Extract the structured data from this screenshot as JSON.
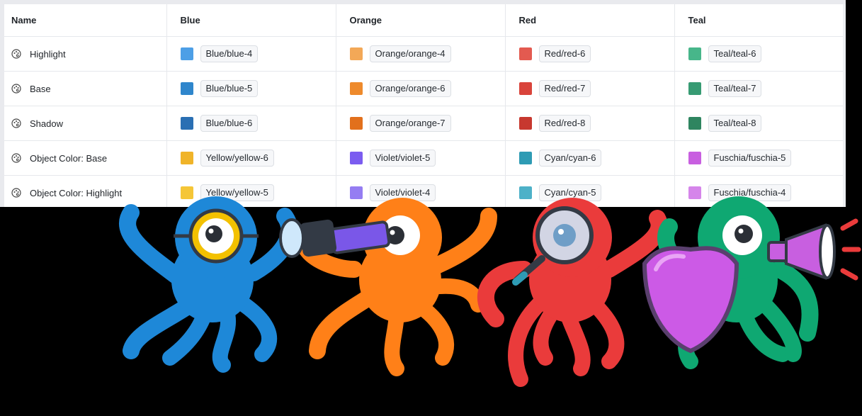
{
  "table": {
    "headers": [
      "Name",
      "Blue",
      "Orange",
      "Red",
      "Teal"
    ],
    "rows": [
      {
        "name": "Highlight",
        "cells": [
          {
            "label": "Blue/blue-4",
            "color": "#4d9fe6"
          },
          {
            "label": "Orange/orange-4",
            "color": "#f3a857"
          },
          {
            "label": "Red/red-6",
            "color": "#e35a50"
          },
          {
            "label": "Teal/teal-6",
            "color": "#47b68a"
          }
        ]
      },
      {
        "name": "Base",
        "cells": [
          {
            "label": "Blue/blue-5",
            "color": "#2f86cc"
          },
          {
            "label": "Orange/orange-6",
            "color": "#ee8a2c"
          },
          {
            "label": "Red/red-7",
            "color": "#d9443b"
          },
          {
            "label": "Teal/teal-7",
            "color": "#379b73"
          }
        ]
      },
      {
        "name": "Shadow",
        "cells": [
          {
            "label": "Blue/blue-6",
            "color": "#2a6fb3"
          },
          {
            "label": "Orange/orange-7",
            "color": "#e2701c"
          },
          {
            "label": "Red/red-8",
            "color": "#c7382f"
          },
          {
            "label": "Teal/teal-8",
            "color": "#2f8560"
          }
        ]
      },
      {
        "name": "Object Color: Base",
        "cells": [
          {
            "label": "Yellow/yellow-6",
            "color": "#f0b429"
          },
          {
            "label": "Violet/violet-5",
            "color": "#7b5cf0"
          },
          {
            "label": "Cyan/cyan-6",
            "color": "#2e9bb4"
          },
          {
            "label": "Fuschia/fuschia-5",
            "color": "#c85fe0"
          }
        ]
      },
      {
        "name": "Object Color: Highlight",
        "cells": [
          {
            "label": "Yellow/yellow-5",
            "color": "#f5c637"
          },
          {
            "label": "Violet/violet-4",
            "color": "#957df2"
          },
          {
            "label": "Cyan/cyan-5",
            "color": "#4db1c8"
          },
          {
            "label": "Fuschia/fuschia-4",
            "color": "#d585ea"
          }
        ]
      }
    ]
  },
  "mascots": [
    {
      "name": "blue-octopus-goggles",
      "body": "#1e88d8",
      "prop": "yellow-goggles"
    },
    {
      "name": "orange-octopus-telescope",
      "body": "#ff8018",
      "prop": "telescope"
    },
    {
      "name": "red-octopus-magnifier",
      "body": "#ea3b3b",
      "prop": "magnifying-glass"
    },
    {
      "name": "green-octopus-megaphone",
      "body": "#0fa872",
      "prop": "shield-and-megaphone"
    }
  ],
  "icons": {
    "row_icon": "palette-icon"
  }
}
